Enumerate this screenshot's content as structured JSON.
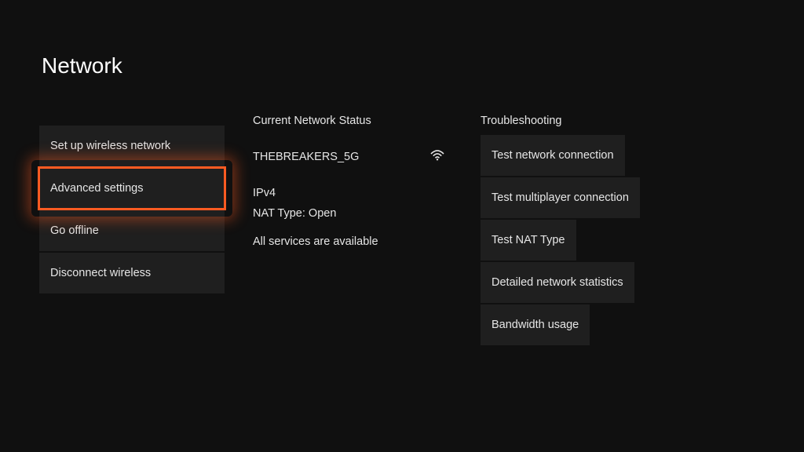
{
  "title": "Network",
  "left_menu": {
    "items": [
      {
        "label": "Set up wireless network"
      },
      {
        "label": "Advanced settings",
        "highlighted": true
      },
      {
        "label": "Go offline"
      },
      {
        "label": "Disconnect wireless"
      }
    ]
  },
  "status": {
    "heading": "Current Network Status",
    "network_name": "THEBREAKERS_5G",
    "ip_version": "IPv4",
    "nat_type": "NAT Type: Open",
    "services": "All services are available"
  },
  "troubleshooting": {
    "heading": "Troubleshooting",
    "items": [
      {
        "label": "Test network connection"
      },
      {
        "label": "Test multiplayer connection"
      },
      {
        "label": "Test NAT Type"
      },
      {
        "label": "Detailed network statistics"
      },
      {
        "label": "Bandwidth usage"
      }
    ]
  },
  "colors": {
    "highlight": "#ff5b22",
    "button_bg": "#1f1f1f",
    "page_bg": "#101010"
  }
}
